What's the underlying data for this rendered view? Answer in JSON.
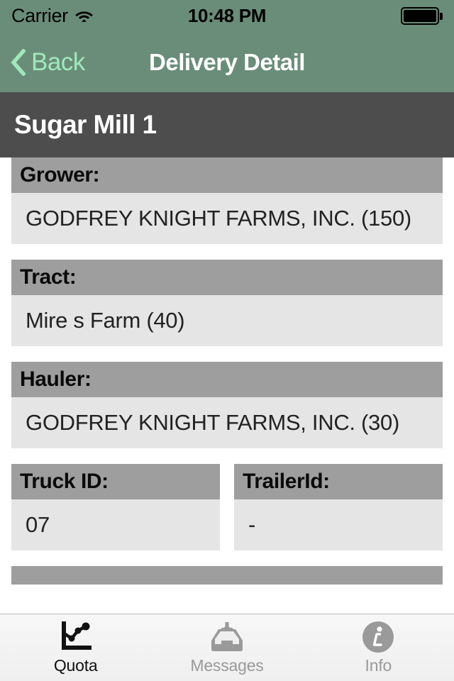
{
  "status_bar": {
    "carrier": "Carrier",
    "wifi_icon": "wifi-icon",
    "time": "10:48 PM",
    "battery_icon": "battery-full-icon",
    "battery_level_percent": 100
  },
  "nav_bar": {
    "back_label": "Back",
    "back_icon": "chevron-left-icon",
    "title": "Delivery Detail",
    "background_color": "#6a8d79",
    "tint_color": "#9fe8bb"
  },
  "subtitle": {
    "text": "Sugar Mill 1",
    "background_color": "#4d4d4d"
  },
  "fields": [
    {
      "label": "Grower:",
      "value": "GODFREY KNIGHT FARMS, INC. (150)"
    },
    {
      "label": "Tract:",
      "value": "Mire s Farm (40)"
    },
    {
      "label": "Hauler:",
      "value": "GODFREY KNIGHT FARMS, INC. (30)"
    }
  ],
  "field_row": [
    {
      "label": "Truck ID:",
      "value": "07"
    },
    {
      "label": "TrailerId:",
      "value": "-"
    }
  ],
  "clipped_field": {
    "label": ""
  },
  "tab_bar": {
    "items": [
      {
        "label": "Quota",
        "icon": "line-chart-icon",
        "active": true
      },
      {
        "label": "Messages",
        "icon": "inbox-tray-icon",
        "active": false
      },
      {
        "label": "Info",
        "icon": "info-circle-icon",
        "active": false
      }
    ],
    "active_color": "#111111",
    "inactive_color": "#9a9a9a"
  }
}
